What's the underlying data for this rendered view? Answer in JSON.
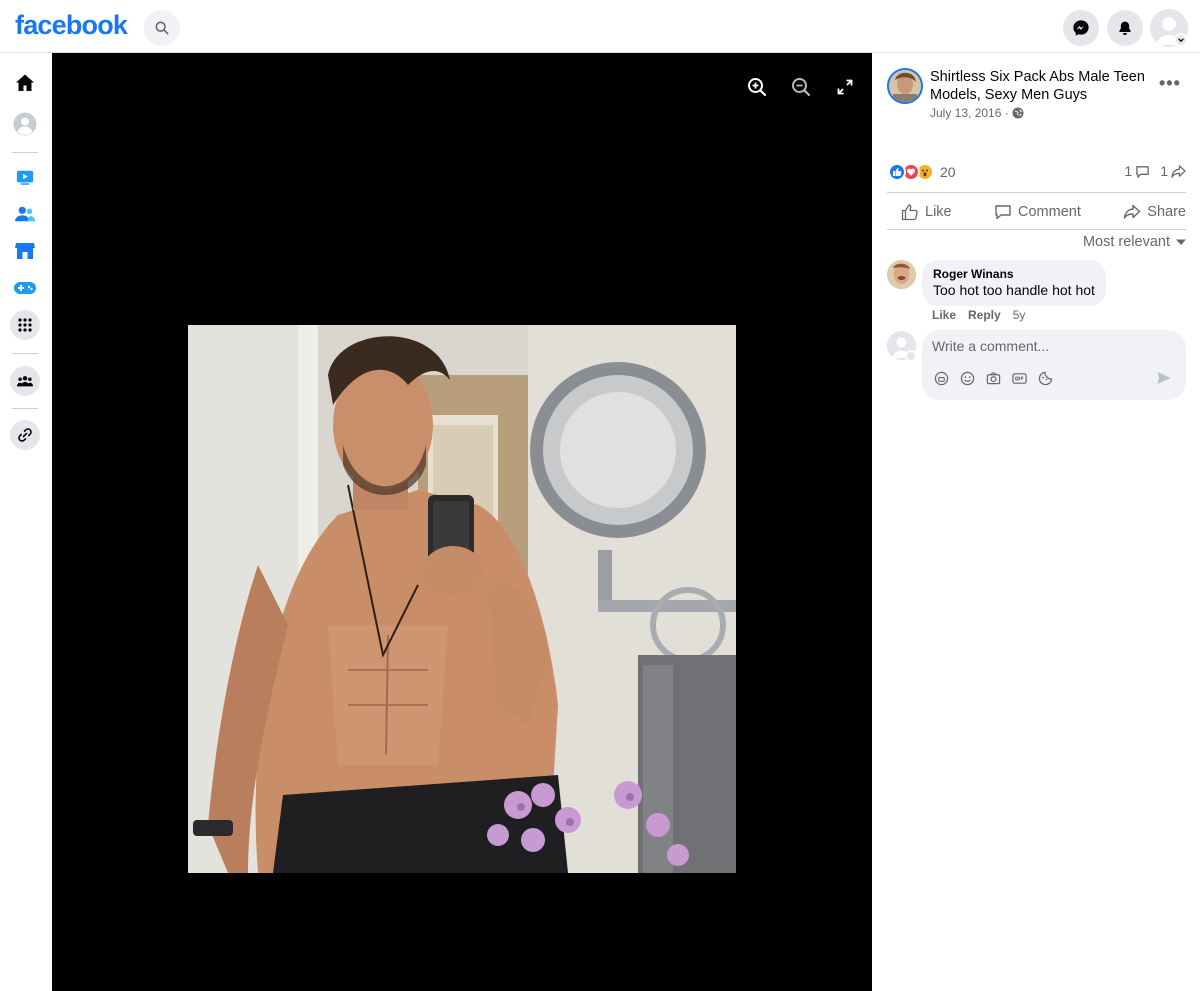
{
  "topbar": {
    "logo": "facebook",
    "icons": [
      "search-icon",
      "messenger-icon",
      "notifications-icon",
      "account-avatar"
    ]
  },
  "leftrail": {
    "items": [
      "home-icon",
      "profile-icon",
      "watch-icon",
      "friends-icon",
      "marketplace-icon",
      "gaming-icon",
      "menu-grid-icon",
      "groups-icon",
      "link-icon"
    ]
  },
  "viewer": {
    "controls": [
      "zoom-in-icon",
      "zoom-out-icon",
      "fullscreen-icon"
    ]
  },
  "post": {
    "page_name": "Shirtless Six Pack Abs Male Teen Models, Sexy Men Guys",
    "date": "July 13, 2016 ·",
    "reaction_count": "20",
    "comment_count": "1",
    "share_count": "1",
    "actions": {
      "like": "Like",
      "comment": "Comment",
      "share": "Share"
    },
    "sort_label": "Most relevant"
  },
  "comments": [
    {
      "author": "Roger Winans",
      "text": "Too hot too handle hot hot",
      "like": "Like",
      "reply": "Reply",
      "age": "5y"
    }
  ],
  "composer": {
    "placeholder": "Write a comment..."
  },
  "colors": {
    "brand": "#1877f2",
    "secondary_text": "#65676b",
    "viewer_bg": "#000000"
  }
}
